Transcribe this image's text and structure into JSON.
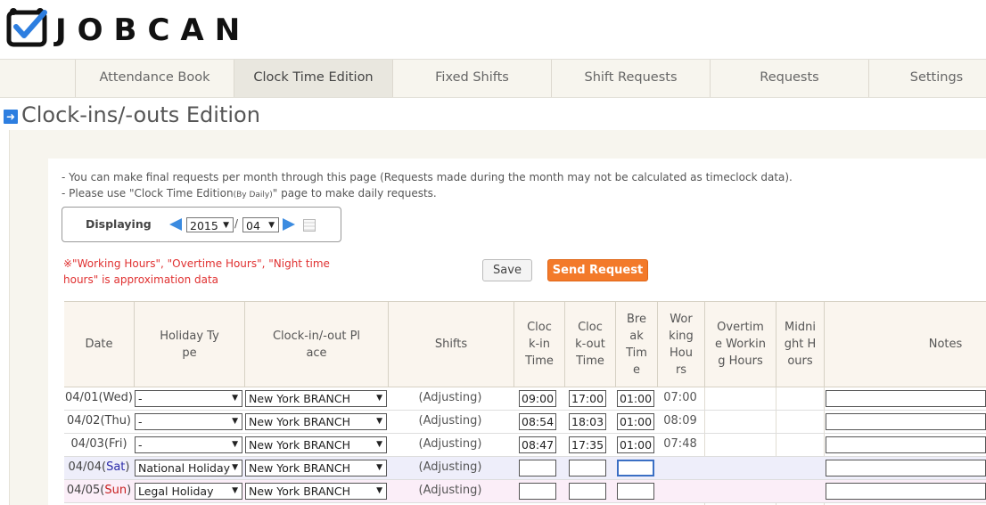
{
  "app": {
    "logo_text": "JOBCAN"
  },
  "nav": {
    "tabs": [
      {
        "label": "Attendance Book",
        "active": false
      },
      {
        "label": "Clock Time Edition",
        "active": true
      },
      {
        "label": "Fixed Shifts",
        "active": false
      },
      {
        "label": "Shift Requests",
        "active": false
      },
      {
        "label": "Requests",
        "active": false
      },
      {
        "label": "Settings",
        "active": false
      }
    ]
  },
  "page": {
    "title": "Clock-ins/-outs Edition",
    "title_icon": "arrow-right-icon"
  },
  "info": {
    "line1": "- You can make final requests per month through this page (Requests made during the month may not be calculated as timeclock data).",
    "line2_prefix": "- Please use \"Clock Time Edition",
    "line2_small": "(By Daily)",
    "line2_suffix": "\" page to make daily requests."
  },
  "display": {
    "label": "Displaying",
    "year": "2015",
    "slash": "/",
    "month": "04"
  },
  "notice": "※\"Working Hours\", \"Overtime Hours\", \"Night time hours\" is approximation data",
  "buttons": {
    "save": "Save",
    "send": "Send Request"
  },
  "colors": {
    "accent_orange": "#f37a2a",
    "accent_blue": "#3b8be0",
    "notice_red": "#e03030"
  },
  "table": {
    "headers": {
      "date": "Date",
      "holiday_type": "Holiday Type",
      "place": "Clock-in/-out Place",
      "shifts": "Shifts",
      "clock_in": "Clock-in Time",
      "clock_out": "Clock-out Time",
      "break": "Break Time",
      "working": "Working Hours",
      "overtime": "Overtime Working Hours",
      "midnight": "Midnight Hours",
      "notes": "Notes"
    },
    "rows": [
      {
        "date": "04/01",
        "weekday": "(Wed)",
        "holiday": "-",
        "place": "New York  BRANCH",
        "shift": "(Adjusting)",
        "in": "09:00",
        "out": "17:00",
        "brk": "01:00",
        "work": "07:00"
      },
      {
        "date": "04/02",
        "weekday": "(Thu)",
        "holiday": "-",
        "place": "New York  BRANCH",
        "shift": "(Adjusting)",
        "in": "08:54",
        "out": "18:03",
        "brk": "01:00",
        "work": "08:09"
      },
      {
        "date": "04/03",
        "weekday": "(Fri)",
        "holiday": "-",
        "place": "New York  BRANCH",
        "shift": "(Adjusting)",
        "in": "08:47",
        "out": "17:35",
        "brk": "01:00",
        "work": "07:48"
      },
      {
        "date": "04/04",
        "weekday": "(Sat)",
        "holiday": "National Holiday",
        "place": "New York  BRANCH",
        "shift": "(Adjusting)",
        "in": "",
        "out": "",
        "brk": "",
        "work": ""
      },
      {
        "date": "04/05",
        "weekday": "(Sun)",
        "holiday": "Legal Holiday",
        "place": "New York  BRANCH",
        "shift": "(Adjusting)",
        "in": "",
        "out": "",
        "brk": "",
        "work": ""
      }
    ]
  }
}
